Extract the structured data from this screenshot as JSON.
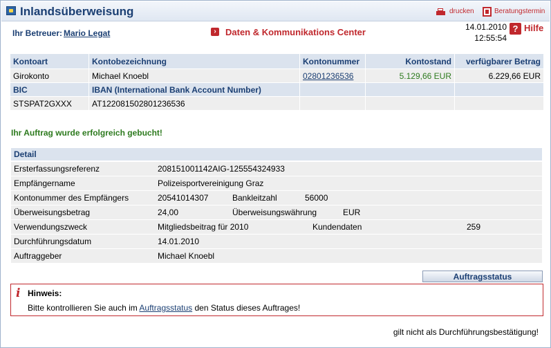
{
  "header": {
    "title": "Inlandsüberweisung",
    "print_label": "drucken",
    "appointment_label": "Beratungstermin"
  },
  "meta": {
    "advisor_label": "Ihr Betreuer:",
    "advisor_name": "Mario Legat",
    "data_center": "Daten & Kommunikations Center",
    "date": "14.01.2010",
    "time": "12:55:54",
    "help": "Hilfe"
  },
  "account": {
    "headers": [
      "Kontoart",
      "Kontobezeichnung",
      "Kontonummer",
      "Kontostand",
      "verfügbarer Betrag"
    ],
    "row": {
      "type": "Girokonto",
      "name": "Michael Knoebl",
      "number": "02801236536",
      "balance": "5.129,66 EUR",
      "available": "6.229,66 EUR"
    },
    "bic_label": "BIC",
    "iban_label": "IBAN (International Bank Account Number)",
    "bic": "STSPAT2GXXX",
    "iban": "AT122081502801236536"
  },
  "success_message": "Ihr Auftrag wurde erfolgreich gebucht!",
  "detail": {
    "title": "Detail",
    "erstref_label": "Ersterfassungsreferenz",
    "erstref": "208151001142AIG-125554324933",
    "empf_label": "Empfängername",
    "empf": "Polizeisportvereinigung Graz",
    "ktonr_label": "Kontonummer des Empfängers",
    "ktonr": "20541014307",
    "blz_label": "Bankleitzahl",
    "blz": "56000",
    "betrag_label": "Überweisungsbetrag",
    "betrag": "24,00",
    "waehrung_label": "Überweisungswährung",
    "waehrung": "EUR",
    "zweck_label": "Verwendungszweck",
    "zweck": "Mitgliedsbeitrag für 2010",
    "kunden_label": "Kundendaten",
    "kunden": "259",
    "datum_label": "Durchführungsdatum",
    "datum": "14.01.2010",
    "auftrag_label": "Auftraggeber",
    "auftrag": "Michael Knoebl"
  },
  "status_button": "Auftragsstatus",
  "hint": {
    "title": "Hinweis:",
    "text_before": "Bitte kontrollieren Sie auch im ",
    "link": "Auftragsstatus",
    "text_after": " den Status dieses Auftrages!"
  },
  "footer": "gilt nicht als Durchführungsbestätigung!",
  "colors": {
    "brand_blue": "#1b3f73",
    "accent_red": "#c0282d",
    "success_green": "#2d7a1e"
  }
}
